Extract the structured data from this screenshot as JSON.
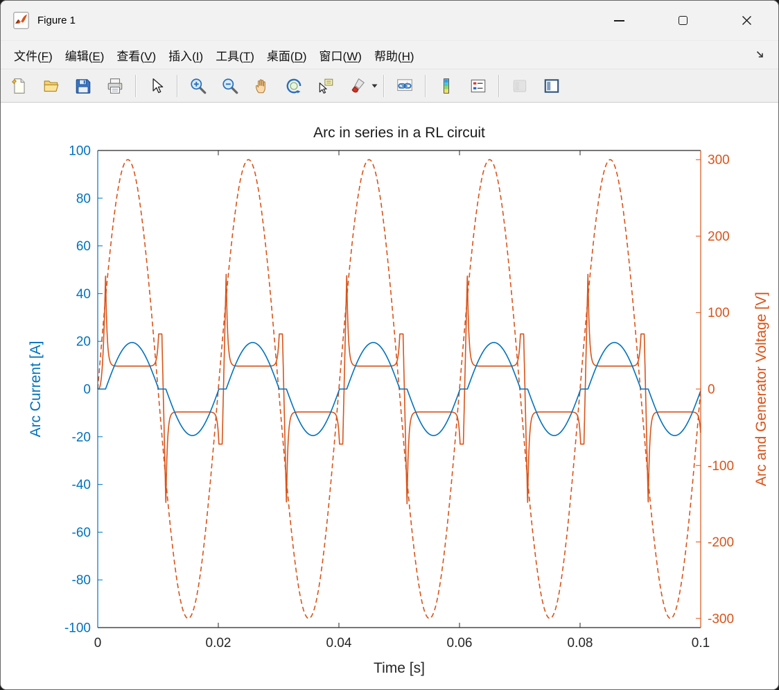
{
  "window": {
    "title": "Figure 1"
  },
  "menubar": {
    "items": [
      {
        "name": "file",
        "label": "文件",
        "mnemonic": "F"
      },
      {
        "name": "edit",
        "label": "编辑",
        "mnemonic": "E"
      },
      {
        "name": "view",
        "label": "查看",
        "mnemonic": "V"
      },
      {
        "name": "insert",
        "label": "插入",
        "mnemonic": "I"
      },
      {
        "name": "tools",
        "label": "工具",
        "mnemonic": "T"
      },
      {
        "name": "desktop",
        "label": "桌面",
        "mnemonic": "D"
      },
      {
        "name": "window",
        "label": "窗口",
        "mnemonic": "W"
      },
      {
        "name": "help",
        "label": "帮助",
        "mnemonic": "H"
      }
    ]
  },
  "toolbar": {
    "items": [
      {
        "type": "button",
        "icon": "new-figure-icon"
      },
      {
        "type": "button",
        "icon": "open-file-icon"
      },
      {
        "type": "button",
        "icon": "save-figure-icon"
      },
      {
        "type": "button",
        "icon": "print-figure-icon"
      },
      {
        "type": "separator"
      },
      {
        "type": "button",
        "icon": "edit-plot-icon"
      },
      {
        "type": "separator"
      },
      {
        "type": "button",
        "icon": "zoom-in-icon"
      },
      {
        "type": "button",
        "icon": "zoom-out-icon"
      },
      {
        "type": "button",
        "icon": "pan-icon"
      },
      {
        "type": "button",
        "icon": "rotate-3d-icon"
      },
      {
        "type": "button",
        "icon": "data-cursor-icon"
      },
      {
        "type": "button",
        "icon": "brush-icon",
        "dropdown": true
      },
      {
        "type": "separator"
      },
      {
        "type": "button",
        "icon": "link-plot-icon"
      },
      {
        "type": "separator"
      },
      {
        "type": "button",
        "icon": "insert-colorbar-icon"
      },
      {
        "type": "button",
        "icon": "insert-legend-icon"
      },
      {
        "type": "separator"
      },
      {
        "type": "button",
        "icon": "hide-plot-tools-icon",
        "disabled": true
      },
      {
        "type": "button",
        "icon": "show-plot-tools-icon"
      }
    ]
  },
  "chart_data": {
    "type": "line",
    "title": "Arc in series in a RL circuit",
    "xlabel": "Time [s]",
    "x_range": [
      0,
      0.1
    ],
    "x_ticks": [
      0,
      0.02,
      0.04,
      0.06,
      0.08,
      0.1
    ],
    "grid": false,
    "legend": "none",
    "left_axis": {
      "label": "Arc Current [A]",
      "color": "#0072BD",
      "range": [
        -100,
        100
      ],
      "ticks": [
        -100,
        -80,
        -60,
        -40,
        -20,
        0,
        20,
        40,
        60,
        80,
        100
      ]
    },
    "right_axis": {
      "label": "Arc and Generator Voltage [V]",
      "color": "#D95319",
      "range": [
        -312,
        312
      ],
      "ticks": [
        -300,
        -200,
        -100,
        0,
        100,
        200,
        300
      ]
    },
    "timing": {
      "frequency_hz": 50,
      "period_s": 0.02,
      "first_ignition_s": 0.0013,
      "dead_time_s": 0.0012,
      "spike_tau_s": 0.00025
    },
    "series": [
      {
        "name": "generator-voltage",
        "axis": "right",
        "line_style": "dashed",
        "color": "#D95319",
        "model": {
          "kind": "sine",
          "amplitude": 300
        }
      },
      {
        "name": "arc-voltage",
        "axis": "right",
        "line_style": "solid",
        "color": "#D95319",
        "model": {
          "kind": "arc-voltage",
          "plateau": 30,
          "reignition_peak": 150,
          "extinction_peak": 72
        }
      },
      {
        "name": "arc-current",
        "axis": "left",
        "line_style": "solid",
        "color": "#0072BD",
        "model": {
          "kind": "arc-current",
          "peak": 19.5
        }
      }
    ]
  }
}
